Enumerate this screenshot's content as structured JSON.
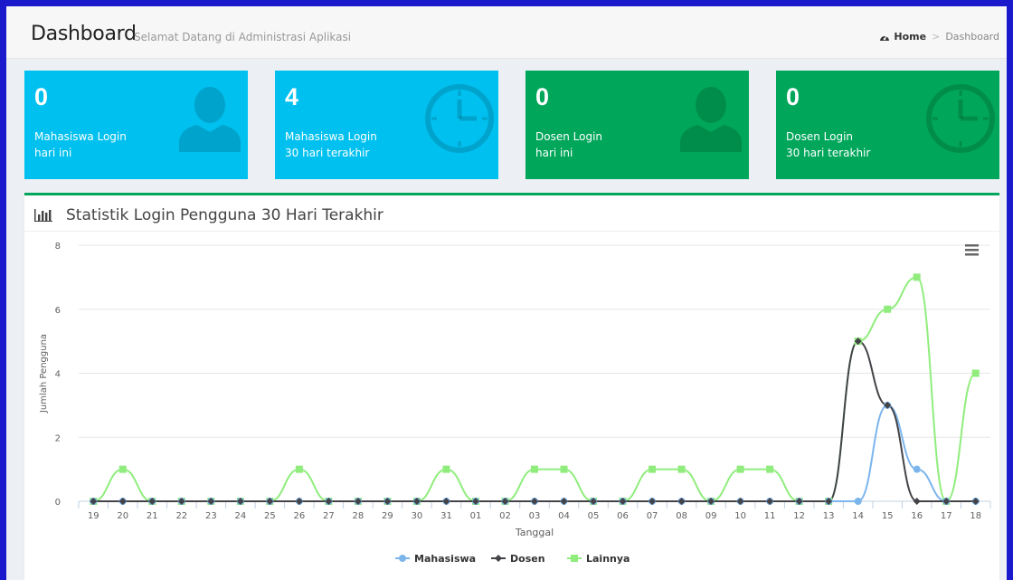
{
  "header": {
    "title": "Dashboard",
    "subtitle": "Selamat Datang di Administrasi Aplikasi",
    "breadcrumb": {
      "home": "Home",
      "current": "Dashboard",
      "separator": ">"
    }
  },
  "stats": [
    {
      "value": "0",
      "label_line1": "Mahasiswa Login",
      "label_line2": "hari ini",
      "icon": "user-icon",
      "color": "#00c0ef"
    },
    {
      "value": "4",
      "label_line1": "Mahasiswa Login",
      "label_line2": "30 hari terakhir",
      "icon": "clock-icon",
      "color": "#00c0ef"
    },
    {
      "value": "0",
      "label_line1": "Dosen Login",
      "label_line2": "hari ini",
      "icon": "user-icon",
      "color": "#00a65a"
    },
    {
      "value": "0",
      "label_line1": "Dosen Login",
      "label_line2": "30 hari terakhir",
      "icon": "clock-icon",
      "color": "#00a65a"
    }
  ],
  "panel": {
    "title": "Statistik Login Pengguna 30 Hari Terakhir",
    "icon": "bar-chart-icon",
    "menu_icon": "hamburger-menu-icon"
  },
  "chart_data": {
    "type": "line",
    "xlabel": "Tanggal",
    "ylabel": "Jumlah Pengguna",
    "ylim": [
      0,
      8
    ],
    "yticks": [
      0,
      2,
      4,
      6,
      8
    ],
    "grid": true,
    "legend_position": "bottom-center",
    "categories": [
      "19",
      "20",
      "21",
      "22",
      "23",
      "24",
      "25",
      "26",
      "27",
      "28",
      "29",
      "30",
      "31",
      "01",
      "02",
      "03",
      "04",
      "05",
      "06",
      "07",
      "08",
      "09",
      "10",
      "11",
      "12",
      "13",
      "14",
      "15",
      "16",
      "17",
      "18"
    ],
    "series": [
      {
        "name": "Mahasiswa",
        "color": "#7cb5ec",
        "marker": "circle",
        "values": [
          0,
          0,
          0,
          0,
          0,
          0,
          0,
          0,
          0,
          0,
          0,
          0,
          0,
          0,
          0,
          0,
          0,
          0,
          0,
          0,
          0,
          0,
          0,
          0,
          0,
          0,
          0,
          3,
          1,
          0,
          0
        ]
      },
      {
        "name": "Dosen",
        "color": "#434348",
        "marker": "diamond",
        "values": [
          0,
          0,
          0,
          0,
          0,
          0,
          0,
          0,
          0,
          0,
          0,
          0,
          0,
          0,
          0,
          0,
          0,
          0,
          0,
          0,
          0,
          0,
          0,
          0,
          0,
          0,
          5,
          3,
          0,
          0,
          0
        ]
      },
      {
        "name": "Lainnya",
        "color": "#90ed7d",
        "marker": "square",
        "values": [
          0,
          1,
          0,
          0,
          0,
          0,
          0,
          1,
          0,
          0,
          0,
          0,
          1,
          0,
          0,
          1,
          1,
          0,
          0,
          1,
          1,
          0,
          1,
          1,
          0,
          0,
          5,
          6,
          7,
          0,
          4
        ]
      }
    ]
  }
}
